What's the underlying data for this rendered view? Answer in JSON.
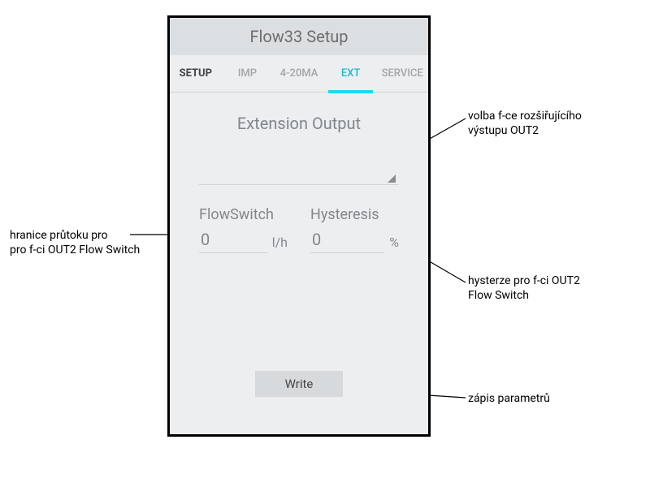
{
  "titlebar": "Flow33 Setup",
  "tabs": {
    "t0": "SETUP",
    "t1": "IMP",
    "t2": "4-20MA",
    "t3": "EXT",
    "t4": "SERVICE"
  },
  "section": "Extension Output",
  "fields": {
    "flow": {
      "label": "FlowSwitch",
      "value": "0",
      "unit": "l/h"
    },
    "hyst": {
      "label": "Hysteresis",
      "value": "0",
      "unit": "%"
    }
  },
  "write": "Write",
  "anno": {
    "ext": "volba f-ce rozšiřujícího\nvýstupu OUT2",
    "flow": "hranice průtoku pro\npro f-ci OUT2 Flow Switch",
    "hyst": "hysterze pro f-ci OUT2\nFlow Switch",
    "write": "zápis parametrů"
  }
}
